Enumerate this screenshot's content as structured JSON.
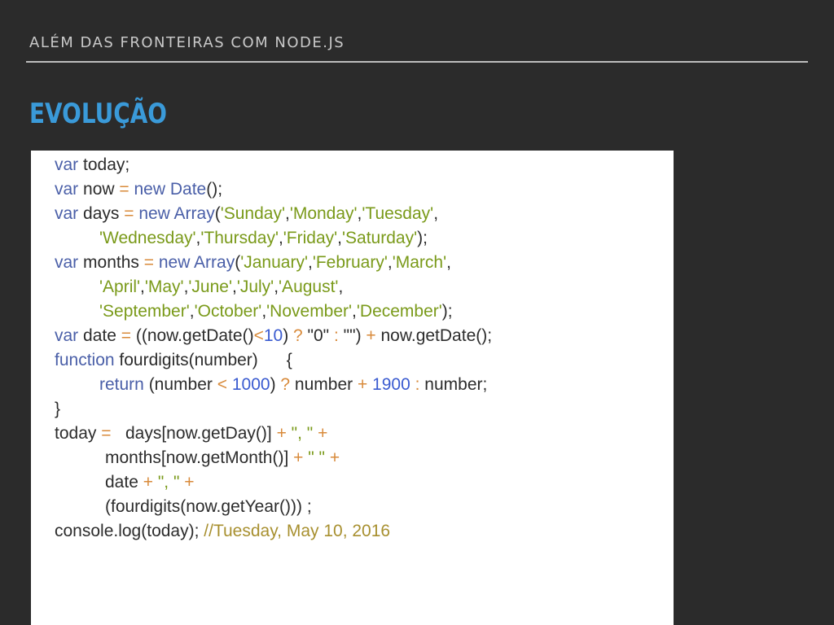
{
  "header": {
    "title": "ALÉM DAS FRONTEIRAS COM NODE.JS"
  },
  "section": {
    "title": "EVOLUÇÃO"
  },
  "code": {
    "l1": {
      "kw": "var",
      "text": " today;"
    },
    "l2": {
      "kw": "var",
      "t1": " now ",
      "op": "=",
      "kw2": " new ",
      "cls": "Date",
      "t2": "();"
    },
    "l3": {
      "kw": "var",
      "t1": " days ",
      "op": "=",
      "kw2": " new ",
      "cls": "Array",
      "t2": "(",
      "s1": "'Sunday'",
      "c1": ",",
      "s2": "'Monday'",
      "c2": ",",
      "s3": "'Tuesday'",
      "c3": ","
    },
    "l4": {
      "s1": "'Wednesday'",
      "c1": ",",
      "s2": "'Thursday'",
      "c2": ",",
      "s3": "'Friday'",
      "c3": ",",
      "s4": "'Saturday'",
      "t": ");"
    },
    "l5": {
      "kw": "var",
      "t1": " months ",
      "op": "=",
      "kw2": " new ",
      "cls": "Array",
      "t2": "(",
      "s1": "'January'",
      "c1": ",",
      "s2": "'February'",
      "c2": ",",
      "s3": "'March'",
      "c3": ","
    },
    "l6": {
      "s1": "'April'",
      "c1": ",",
      "s2": "'May'",
      "c2": ",",
      "s3": "'June'",
      "c3": ",",
      "s4": "'July'",
      "c4": ",",
      "s5": "'August'",
      "c5": ","
    },
    "l7": {
      "s1": "'September'",
      "c1": ",",
      "s2": "'October'",
      "c2": ",",
      "s3": "'November'",
      "c3": ",",
      "s4": "'December'",
      "t": ");"
    },
    "l8": {
      "kw": "var",
      "t1": " date ",
      "op": "=",
      "t2": " ((now.getDate()",
      "op2": "<",
      "num": "10",
      "t3": ") ",
      "op3": "?",
      "s1": " \"0\" ",
      "op4": ":",
      "s2": " \"\"",
      "t4": ") ",
      "op5": "+",
      "t5": " now.getDate();"
    },
    "l9": {
      "kw": "function",
      "t": " fourdigits(number)      {"
    },
    "l10": {
      "kw": "return",
      "t1": " (number ",
      "op": "<",
      "num": " 1000",
      "t2": ") ",
      "op2": "?",
      "t3": " number ",
      "op3": "+",
      "num2": " 1900",
      "op4": " :",
      "t4": " number;"
    },
    "l11": {
      "t": "}"
    },
    "l12": {
      "t1": "today ",
      "op": "=",
      "t2": "   days[now.getDay()] ",
      "op2": "+",
      "s": " \", \" ",
      "op3": "+"
    },
    "l13": {
      "t1": "months[now.getMonth()] ",
      "op": "+",
      "s": " \" \" ",
      "op2": "+"
    },
    "l14": {
      "t1": "date ",
      "op": "+",
      "s": " \", \" ",
      "op2": "+"
    },
    "l15": {
      "t": "(fourdigits(now.getYear())) ;"
    },
    "l16": {
      "t": "console.log(today); ",
      "cmt": "//Tuesday, May 10, 2016"
    }
  }
}
